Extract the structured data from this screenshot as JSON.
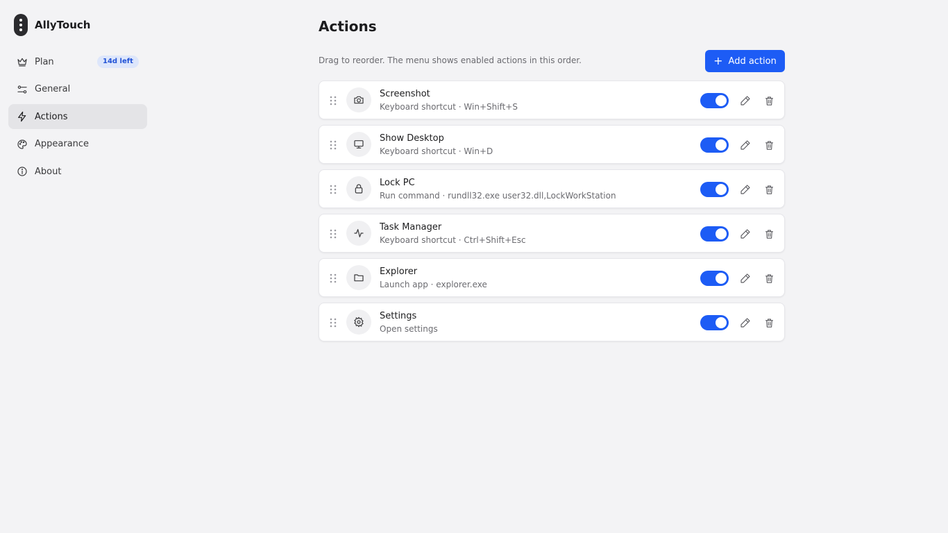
{
  "app": {
    "name": "AllyTouch"
  },
  "sidebar": {
    "items": [
      {
        "label": "Plan",
        "icon": "crown-icon",
        "badge": "14d left"
      },
      {
        "label": "General",
        "icon": "sliders-icon"
      },
      {
        "label": "Actions",
        "icon": "lightning-icon",
        "active": true
      },
      {
        "label": "Appearance",
        "icon": "palette-icon"
      },
      {
        "label": "About",
        "icon": "info-icon"
      }
    ]
  },
  "main": {
    "title": "Actions",
    "hint": "Drag to reorder. The menu shows enabled actions in this order.",
    "add_button_label": "Add action",
    "actions": [
      {
        "name": "Screenshot",
        "description": "Keyboard shortcut · Win+Shift+S",
        "icon": "camera-icon",
        "enabled": true
      },
      {
        "name": "Show Desktop",
        "description": "Keyboard shortcut · Win+D",
        "icon": "monitor-icon",
        "enabled": true
      },
      {
        "name": "Lock PC",
        "description": "Run command · rundll32.exe user32.dll,LockWorkStation",
        "icon": "lock-icon",
        "enabled": true
      },
      {
        "name": "Task Manager",
        "description": "Keyboard shortcut · Ctrl+Shift+Esc",
        "icon": "activity-icon",
        "enabled": true
      },
      {
        "name": "Explorer",
        "description": "Launch app · explorer.exe",
        "icon": "folder-icon",
        "enabled": true
      },
      {
        "name": "Settings",
        "description": "Open settings",
        "icon": "gear-icon",
        "enabled": true
      }
    ]
  },
  "colors": {
    "accent": "#1d5cf5",
    "background": "#f3f3f5",
    "badge_bg": "#dde6fb",
    "badge_text": "#2152d6"
  }
}
